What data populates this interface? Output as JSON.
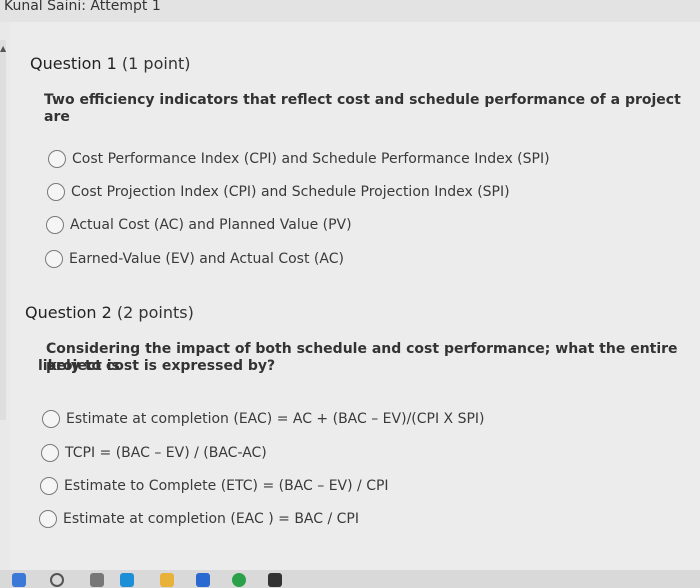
{
  "header": {
    "title": "Kunal Saini: Attempt 1"
  },
  "questions": [
    {
      "number": "Question 1",
      "points": "(1 point)",
      "prompt": "Two efficiency indicators that reflect cost and schedule performance of a project are",
      "options": [
        "Cost Performance Index (CPI) and Schedule Performance Index (SPI)",
        "Cost Projection Index (CPI) and Schedule Projection Index (SPI)",
        "Actual Cost (AC) and Planned Value (PV)",
        "Earned-Value (EV) and Actual Cost (AC)"
      ]
    },
    {
      "number": "Question 2",
      "points": "(2 points)",
      "prompt_line1": "Considering the impact of both schedule and cost performance; what the entire project is",
      "prompt_line2": "likely to cost is expressed by?",
      "options": [
        "Estimate at completion (EAC) = AC + (BAC – EV)/(CPI X SPI)",
        "TCPI = (BAC – EV) / (BAC-AC)",
        "Estimate to Complete (ETC) = (BAC – EV) / CPI",
        "Estimate at completion (EAC ) = BAC / CPI"
      ]
    }
  ],
  "taskbar": {
    "icons": [
      "windows-icon",
      "search-icon",
      "task-icon",
      "edge-icon",
      "explorer-icon",
      "store-icon",
      "chrome-icon",
      "app-icon"
    ],
    "colors": [
      "#3b78d8",
      "#555555",
      "#777777",
      "#1c8fd6",
      "#e8b23a",
      "#2a6ad0",
      "#2aa14a",
      "#333333"
    ]
  }
}
